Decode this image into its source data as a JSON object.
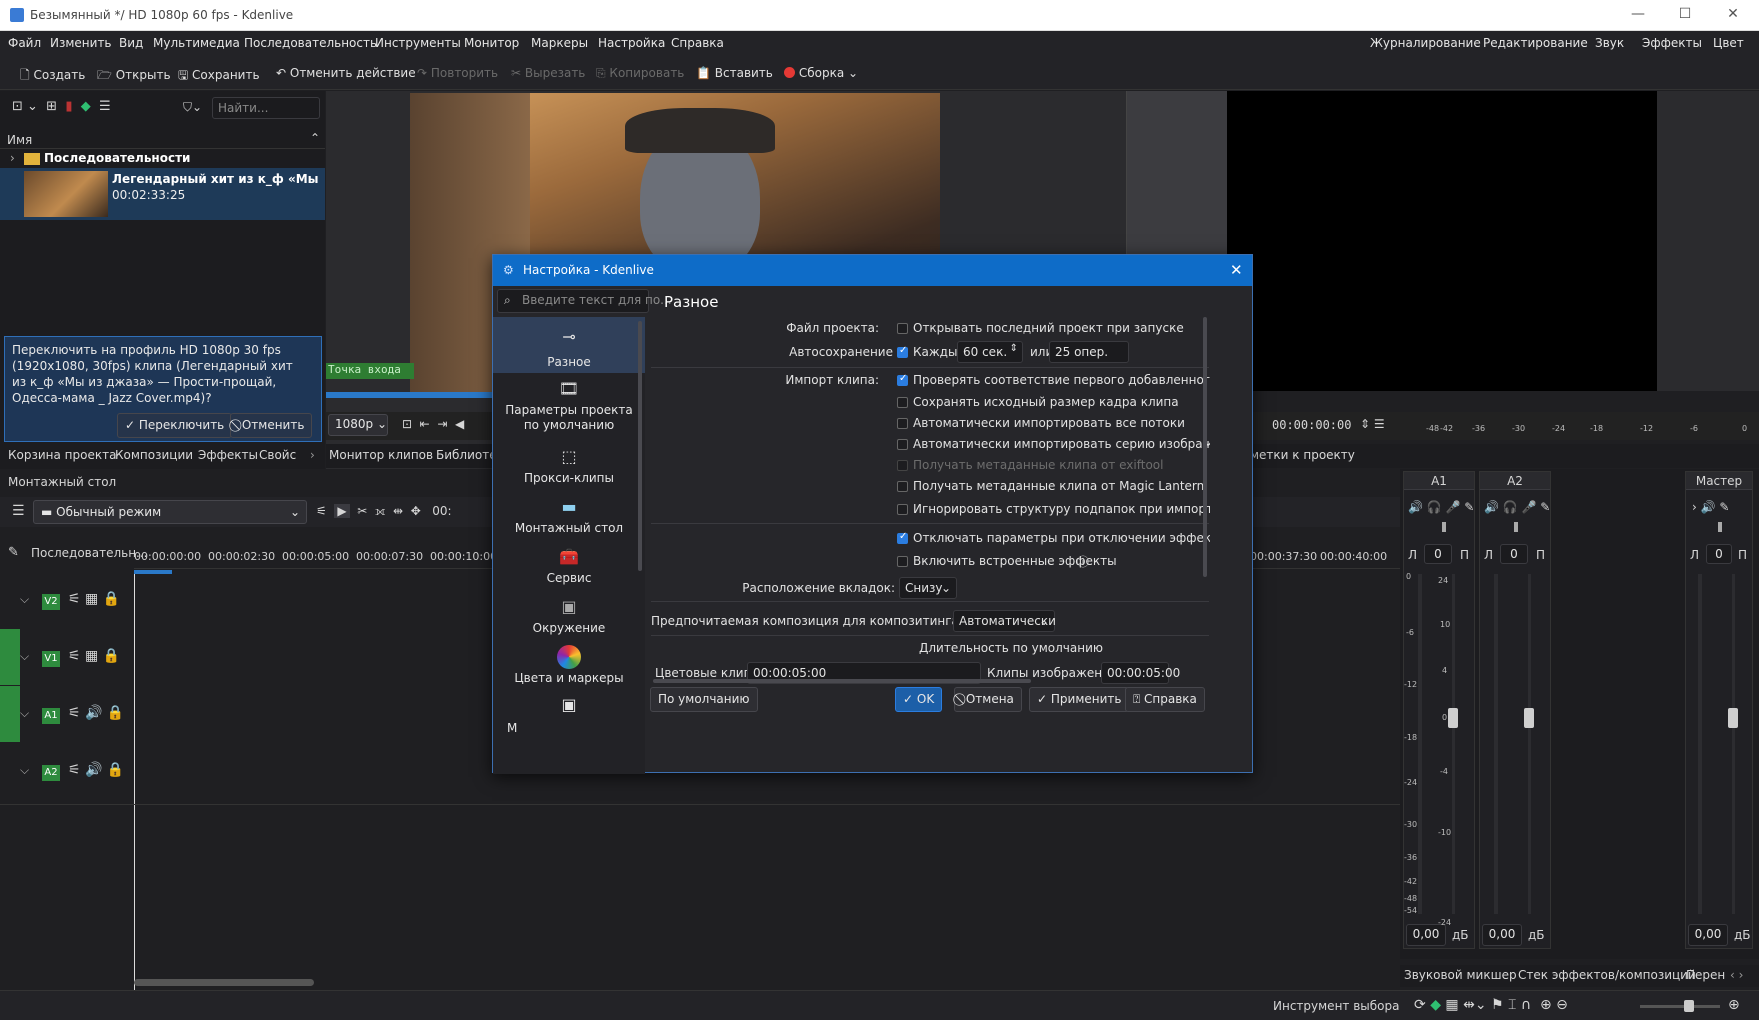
{
  "window": {
    "title": "Безымянный */ HD 1080p 60 fps - Kdenlive"
  },
  "menu": [
    "Файл",
    "Изменить",
    "Вид",
    "Мультимедиа",
    "Последовательность",
    "Инструменты",
    "Монитор",
    "Маркеры",
    "Настройка",
    "Справка"
  ],
  "layouts": [
    "Журналирование",
    "Редактирование",
    "Звук",
    "Эффекты",
    "Цвет"
  ],
  "toolbar": {
    "new": "Создать",
    "open": "Открыть",
    "save": "Сохранить",
    "undo": "Отменить действие",
    "redo": "Повторить",
    "cut": "Вырезать",
    "copy": "Копировать",
    "paste": "Вставить",
    "render": "Сборка"
  },
  "bin": {
    "search_placeholder": "Найти...",
    "column_name": "Имя",
    "folder": "Последовательности",
    "clip_name": "Легендарный хит из к_ф «Мы из д:",
    "clip_duration": "00:02:33:25"
  },
  "profile_prompt": {
    "text": "Переключить на профиль HD 1080p 30 fps (1920x1080, 30fps) клипа (Легендарный хит из к_ф «Мы из джаза» — Прости-прощай, Одесса-мама _ Jazz Cover.mp4)?",
    "switch": "Переключить",
    "cancel": "Отменить"
  },
  "bin_tabs": [
    "Корзина проекта",
    "Композиции",
    "Эффекты",
    "Свойс"
  ],
  "monitor": {
    "in_point": "Точка входа",
    "zoom": "1080p",
    "timecode_right": "00:00:00:00"
  },
  "monitor_tabs": [
    "Монитор клипов",
    "Библиоте"
  ],
  "project_notes_tab": "метки к проекту",
  "timeline": {
    "title": "Монтажный стол",
    "mode": "Обычный режим",
    "sequence": "Последовательн...",
    "ticks": [
      "00:00:00:00",
      "00:00:02:30",
      "00:00:05:00",
      "00:00:07:30",
      "00:00:10:00"
    ],
    "ticks_right": [
      "00:00:37:30",
      "00:00:40:00"
    ],
    "tracks": [
      "V2",
      "V1",
      "A1",
      "A2"
    ],
    "tool_label": "Инструмент выбора"
  },
  "mixer": {
    "channels": [
      {
        "name": "A1",
        "balance": "0",
        "volume": "0,00"
      },
      {
        "name": "A2",
        "balance": "0",
        "volume": "0,00"
      },
      {
        "name": "Мастер",
        "balance": "0",
        "volume": "0,00"
      }
    ],
    "lr_left": "Л",
    "lr_right": "П",
    "db_unit": "дБ",
    "scale": [
      "24",
      "10",
      "4",
      "0",
      "-4",
      "-10",
      "-24"
    ],
    "scale_left": [
      "0",
      "-6",
      "-12",
      "-18",
      "-24",
      "-30",
      "-36",
      "-42",
      "-48",
      "-54"
    ],
    "top_scale": [
      "-48",
      "-42",
      "-36",
      "-30",
      "-24",
      "-18",
      "-12",
      "-6",
      "0"
    ],
    "tabs": [
      "Звуковой микшер",
      "Стек эффектов/композиций",
      "Перен"
    ]
  },
  "dialog": {
    "title": "Настройка - Kdenlive",
    "search_placeholder": "Введите текст для по...",
    "page_title": "Разное",
    "categories": [
      "Разное",
      "Параметры проекта по умолчанию",
      "Прокси-клипы",
      "Монтажный стол",
      "Сервис",
      "Окружение",
      "Цвета и маркеры",
      "М"
    ],
    "project_file_label": "Файл проекта:",
    "open_last": "Открывать последний проект при запуске",
    "autosave_label": "Автосохранение",
    "every": "Каждые",
    "autosave_seconds": "60 сек.",
    "or": "или",
    "autosave_ops": "25 опер.",
    "import_label": "Импорт клипа:",
    "import_opts": [
      {
        "text": "Проверять соответствие первого добавленного клипа",
        "checked": true,
        "disabled": false
      },
      {
        "text": "Сохранять исходный размер кадра клипа",
        "checked": false,
        "disabled": false
      },
      {
        "text": "Автоматически импортировать все потоки",
        "checked": false,
        "disabled": false
      },
      {
        "text": "Автоматически импортировать серию изображений",
        "checked": false,
        "disabled": false
      },
      {
        "text": "Получать метаданные клипа от exiftool",
        "checked": false,
        "disabled": true
      },
      {
        "text": "Получать метаданные клипа от Magic Lantern",
        "checked": false,
        "disabled": false
      },
      {
        "text": "Игнорировать структуру подпапок при импорте",
        "checked": false,
        "disabled": false
      }
    ],
    "disable_params": "Отключать параметры при отключении эффекта",
    "builtin_effects": "Включить встроенные эффекты",
    "tab_position_label": "Расположение вкладок:",
    "tab_position": "Снизу",
    "composition_label": "Предпочитаемая композиция для композитинга дорожек:",
    "composition": "Автоматически",
    "default_duration": "Длительность по умолчанию",
    "color_clips_label": "Цветовые клипы:",
    "color_clips": "00:00:05:00",
    "image_clips_label": "Клипы изображений:",
    "image_clips": "00:00:05:00",
    "buttons": {
      "defaults": "По умолчанию",
      "ok": "OK",
      "cancel": "Отмена",
      "apply": "Применить",
      "help": "Справка"
    }
  },
  "colors": {
    "accent": "#0e6cc8",
    "track_green": "#2e8b3e",
    "render_dot": "#e53935"
  }
}
